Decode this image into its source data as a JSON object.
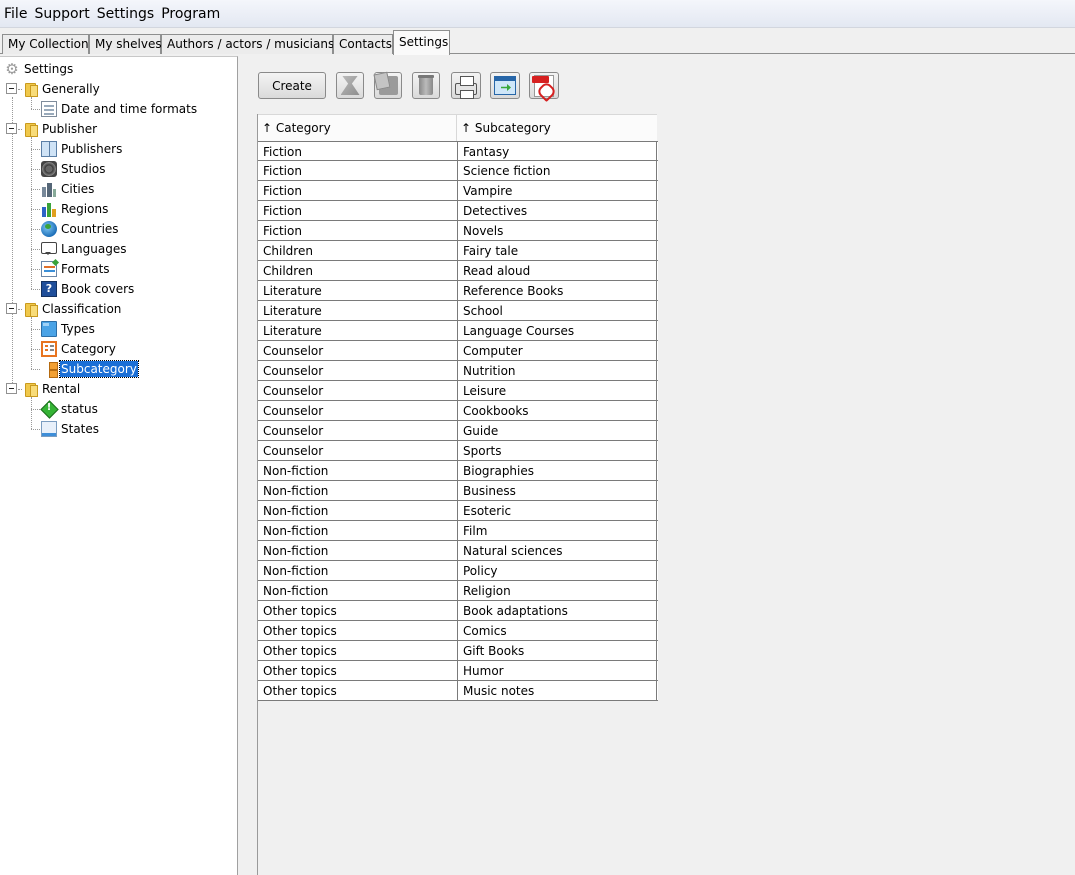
{
  "menu": [
    "File",
    "Support",
    "Settings",
    "Program"
  ],
  "tabs": [
    "My Collection",
    "My shelves",
    "Authors / actors / musicians",
    "Contacts",
    "Settings"
  ],
  "tree": {
    "root": "Settings",
    "generally": "Generally",
    "date_time_formats": "Date and time formats",
    "publisher": "Publisher",
    "publishers": "Publishers",
    "studios": "Studios",
    "cities": "Cities",
    "regions": "Regions",
    "countries": "Countries",
    "languages": "Languages",
    "formats": "Formats",
    "book_covers": "Book covers",
    "classification": "Classification",
    "types": "Types",
    "category": "Category",
    "subcategory": "Subcategory",
    "rental": "Rental",
    "status": "status",
    "states": "States"
  },
  "toolbar": {
    "create_label": "Create"
  },
  "table": {
    "headers": [
      "↑ Category",
      "↑ Subcategory"
    ],
    "rows": [
      [
        "Fiction",
        "Fantasy"
      ],
      [
        "Fiction",
        "Science fiction"
      ],
      [
        "Fiction",
        "Vampire"
      ],
      [
        "Fiction",
        "Detectives"
      ],
      [
        "Fiction",
        "Novels"
      ],
      [
        "Children",
        "Fairy tale"
      ],
      [
        "Children",
        "Read aloud"
      ],
      [
        "Literature",
        "Reference Books"
      ],
      [
        "Literature",
        "School"
      ],
      [
        "Literature",
        "Language Courses"
      ],
      [
        "Counselor",
        "Computer"
      ],
      [
        "Counselor",
        "Nutrition"
      ],
      [
        "Counselor",
        "Leisure"
      ],
      [
        "Counselor",
        "Cookbooks"
      ],
      [
        "Counselor",
        "Guide"
      ],
      [
        "Counselor",
        "Sports"
      ],
      [
        "Non-fiction",
        "Biographies"
      ],
      [
        "Non-fiction",
        "Business"
      ],
      [
        "Non-fiction",
        "Esoteric"
      ],
      [
        "Non-fiction",
        "Film"
      ],
      [
        "Non-fiction",
        "Natural sciences"
      ],
      [
        "Non-fiction",
        "Policy"
      ],
      [
        "Non-fiction",
        "Religion"
      ],
      [
        "Other topics",
        "Book adaptations"
      ],
      [
        "Other topics",
        "Comics"
      ],
      [
        "Other topics",
        "Gift Books"
      ],
      [
        "Other topics",
        "Humor"
      ],
      [
        "Other topics",
        "Music notes"
      ]
    ]
  },
  "colors": {
    "selection": "#1b6fd6",
    "panel_bg": "#f0f0f0"
  }
}
